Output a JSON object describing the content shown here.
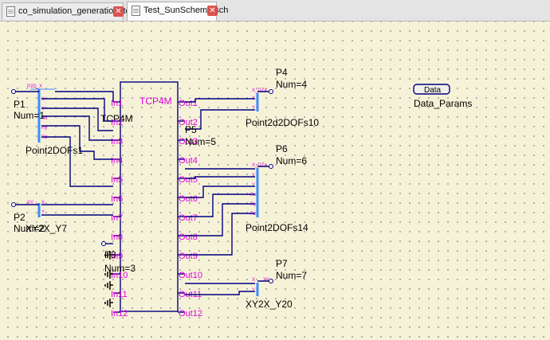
{
  "tabs": [
    {
      "label": "co_simulation_generation_test.sch",
      "active": false
    },
    {
      "label": "Test_SunScheme.sch",
      "active": true
    }
  ],
  "tcp4m": {
    "title": "TCP4M",
    "instance": "TCP4M",
    "inputs": [
      "In1",
      "In2",
      "In3",
      "In4",
      "In5",
      "In6",
      "In7",
      "In8",
      "In9",
      "In10",
      "In11",
      "In12"
    ],
    "outputs": [
      "Out1",
      "Out2",
      "Out3",
      "Out4",
      "Out5",
      "Out6",
      "Out7",
      "Out8",
      "Out9",
      "Out10",
      "Out11",
      "Out12"
    ]
  },
  "ports": {
    "p1": {
      "name": "P1",
      "num": "Num=1"
    },
    "p2": {
      "name": "P2",
      "num": "Num=2"
    },
    "p3": {
      "name": "P3",
      "num": "Num=3"
    },
    "p4": {
      "name": "P4",
      "num": "Num=4"
    },
    "p5": {
      "name": "P5",
      "num": "Num=5"
    },
    "p6": {
      "name": "P6",
      "num": "Num=6"
    },
    "p7": {
      "name": "P7",
      "num": "Num=7"
    }
  },
  "blocks": {
    "point2dofs1": {
      "name": "Point2DOFs1",
      "pins": [
        "P2D_X",
        "X",
        "Y",
        "Rx",
        "Ry",
        "Rz"
      ]
    },
    "xy2x_y7": {
      "name": "XY2X_Y7",
      "pins": [
        "XY",
        "X",
        "Y"
      ]
    },
    "point2d2dofs10": {
      "name": "Point2d2DOFs10",
      "pins": [
        "X_DZa",
        "X",
        "Y"
      ]
    },
    "point2dofs14": {
      "name": "Point2DOFs14",
      "pins": [
        "X_DZa",
        "X",
        "Y",
        "Rx",
        "Ry",
        "Rz"
      ]
    },
    "xy2x_y20": {
      "name": "XY2X_Y20",
      "pins": [
        "X",
        "XY",
        "Y"
      ]
    }
  },
  "data_block": {
    "label": "Data",
    "name": "Data_Params"
  },
  "colors": {
    "wire": "#000080",
    "port_text": "#e000e0",
    "block": "#3c8cff",
    "canvas": "#f6f2d8"
  }
}
